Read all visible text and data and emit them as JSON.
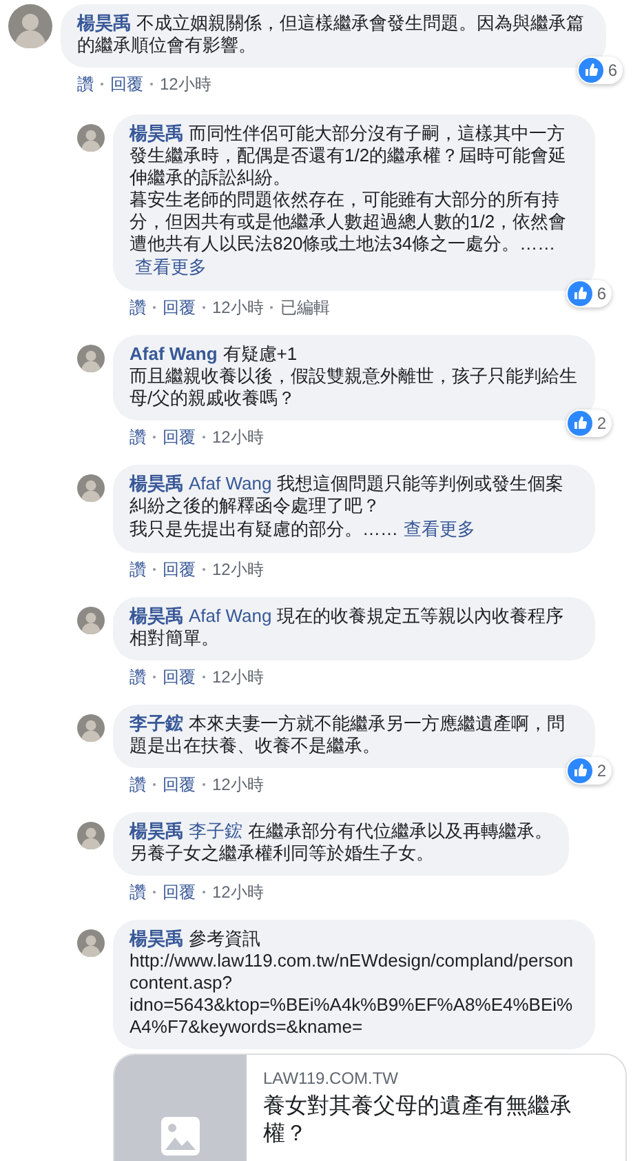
{
  "comments": [
    {
      "author": "楊昊禹",
      "text": [
        "不成立姻親關係，但這樣繼承會發生問題。因為與繼承篇的繼承順位會有影響。"
      ],
      "actions": [
        "讚",
        "回覆",
        "12小時"
      ],
      "likes": "6",
      "replies": [
        {
          "author": "楊昊禹",
          "text": [
            "而同性伴侶可能大部分沒有子嗣，這樣其中一方發生繼承時，配偶是否還有1/2的繼承權？屆時可能會延伸繼承的訴訟糾紛。",
            "暮安生老師的問題依然存在，可能雖有大部分的所有持分，但因共有或是他繼承人數超過總人數的1/2，依然會遭他共有人以民法820條或土地法34條之一處分。……"
          ],
          "see_more": "查看更多",
          "actions": [
            "讚",
            "回覆",
            "12小時",
            "已編輯"
          ],
          "likes": "6"
        },
        {
          "author": "Afaf Wang",
          "text": [
            "有疑慮+1",
            "而且繼親收養以後，假設雙親意外離世，孩子只能判給生母/父的親戚收養嗎？"
          ],
          "actions": [
            "讚",
            "回覆",
            "12小時"
          ],
          "likes": "2"
        },
        {
          "author": "楊昊禹",
          "mention": "Afaf Wang",
          "text": [
            "我想這個問題只能等判例或發生個案糾紛之後的解釋函令處理了吧？",
            "我只是先提出有疑慮的部分。……"
          ],
          "see_more": "查看更多",
          "actions": [
            "讚",
            "回覆",
            "12小時"
          ]
        },
        {
          "author": "楊昊禹",
          "mention": "Afaf Wang",
          "text": [
            "現在的收養規定五等親以內收養程序相對簡單。"
          ],
          "actions": [
            "讚",
            "回覆",
            "12小時"
          ]
        },
        {
          "author": "李子鋐",
          "text": [
            "本來夫妻一方就不能繼承另一方應繼遺產啊，問題是出在扶養、收養不是繼承。"
          ],
          "actions": [
            "讚",
            "回覆",
            "12小時"
          ],
          "likes": "2"
        },
        {
          "author": "楊昊禹",
          "mention": "李子鋐",
          "text": [
            "在繼承部分有代位繼承以及再轉繼承。",
            "另養子女之繼承權利同等於婚生子女。"
          ],
          "actions": [
            "讚",
            "回覆",
            "12小時"
          ]
        },
        {
          "author": "楊昊禹",
          "text": [
            "參考資訊",
            "http://www.law119.com.tw/nEWdesign/compland/personcontent.asp?idno=5643&ktop=%BEi%A4k%B9%EF%A8%E4%BEi%A4%F7&keywords=&kname="
          ],
          "preview": {
            "domain": "LAW119.COM.TW",
            "title": "養女對其養父母的遺產有無繼承權？"
          }
        }
      ]
    }
  ]
}
